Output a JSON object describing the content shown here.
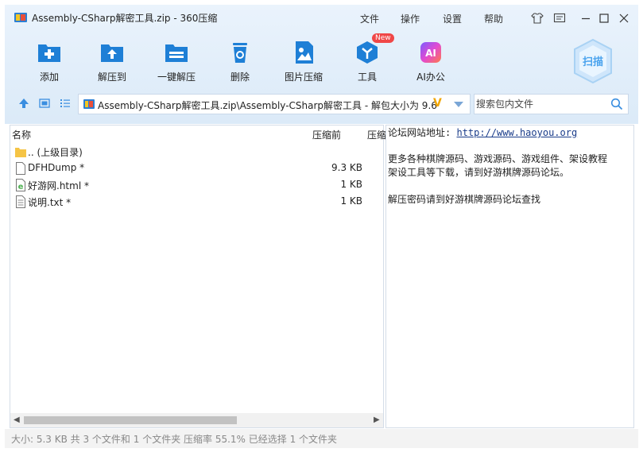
{
  "window": {
    "title": "Assembly-CSharp解密工具.zip - 360压缩"
  },
  "menu": [
    "文件",
    "操作",
    "设置",
    "帮助"
  ],
  "toolbar": {
    "items": [
      {
        "label": "添加",
        "icon": "add-icon"
      },
      {
        "label": "解压到",
        "icon": "extract-to-icon"
      },
      {
        "label": "一键解压",
        "icon": "one-click-extract-icon"
      },
      {
        "label": "删除",
        "icon": "delete-icon"
      },
      {
        "label": "图片压缩",
        "icon": "image-compress-icon"
      },
      {
        "label": "工具",
        "icon": "tools-icon"
      },
      {
        "label": "AI办公",
        "icon": "ai-office-icon"
      }
    ],
    "new_badge": "New",
    "ai_icon_text": "AI",
    "scan_label": "扫描"
  },
  "address": {
    "path": "Assembly-CSharp解密工具.zip\\Assembly-CSharp解密工具 - 解包大小为 9.6",
    "vip_mark": "V"
  },
  "search": {
    "placeholder": "搜索包内文件"
  },
  "file_list": {
    "columns": {
      "name": "名称",
      "packed": "压缩前",
      "ratio": "压缩"
    },
    "rows": [
      {
        "name": ".. (上级目录)",
        "size": "",
        "icon": "folder-up-icon"
      },
      {
        "name": "DFHDump *",
        "size": "9.3 KB",
        "icon": "file-icon"
      },
      {
        "name": "好游网.html *",
        "size": "1 KB",
        "icon": "html-file-icon"
      },
      {
        "name": "说明.txt *",
        "size": "1 KB",
        "icon": "text-file-icon"
      }
    ]
  },
  "comment": {
    "site_label": "论坛网站地址:",
    "site_url": "http://www.haoyou.org",
    "line2": "更多各种棋牌源码、游戏源码、游戏组件、架设教程",
    "line3": "架设工具等下载，请到好游棋牌源码论坛。",
    "line4": "解压密码请到好游棋牌源码论坛查找"
  },
  "status": {
    "text": "大小: 5.3 KB 共 3 个文件和 1 个文件夹 压缩率 55.1% 已经选择 1 个文件夹"
  },
  "colors": {
    "accent": "#1e7fd6",
    "header_bg": "#dbeaf8",
    "badge": "#f04747"
  }
}
